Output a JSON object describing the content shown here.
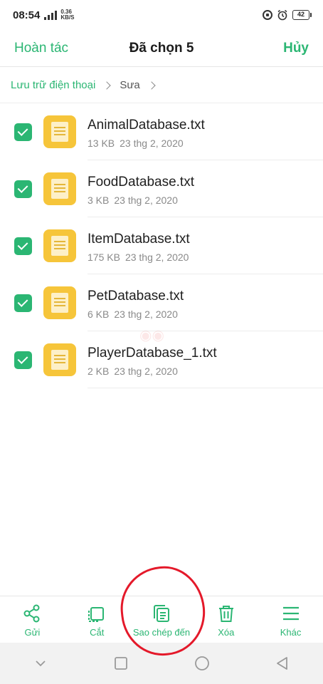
{
  "status_bar": {
    "time": "08:54",
    "net_speed_value": "0.36",
    "net_speed_unit": "KB/S",
    "battery_level": "42"
  },
  "header": {
    "undo_label": "Hoàn tác",
    "title": "Đã chọn 5",
    "cancel_label": "Hủy"
  },
  "breadcrumb": {
    "root": "Lưu trữ điện thoại",
    "folder": "Sưa"
  },
  "files": [
    {
      "name": "AnimalDatabase.txt",
      "size": "13 KB",
      "date": "23 thg 2, 2020",
      "checked": true
    },
    {
      "name": "FoodDatabase.txt",
      "size": "3 KB",
      "date": "23 thg 2, 2020",
      "checked": true
    },
    {
      "name": "ItemDatabase.txt",
      "size": "175 KB",
      "date": "23 thg 2, 2020",
      "checked": true
    },
    {
      "name": "PetDatabase.txt",
      "size": "6 KB",
      "date": "23 thg 2, 2020",
      "checked": true
    },
    {
      "name": "PlayerDatabase_1.txt",
      "size": "2 KB",
      "date": "23 thg 2, 2020",
      "checked": true
    }
  ],
  "actions": {
    "send": {
      "label": "Gửi",
      "icon": "share-icon"
    },
    "cut": {
      "label": "Cắt",
      "icon": "cut-icon"
    },
    "copy_to": {
      "label": "Sao chép đến",
      "icon": "copy-icon"
    },
    "delete": {
      "label": "Xóa",
      "icon": "trash-icon"
    },
    "more": {
      "label": "Khác",
      "icon": "menu-icon"
    }
  },
  "colors": {
    "accent": "#2bb673",
    "file_icon": "#f6c53a",
    "annotation": "#e4192a"
  }
}
